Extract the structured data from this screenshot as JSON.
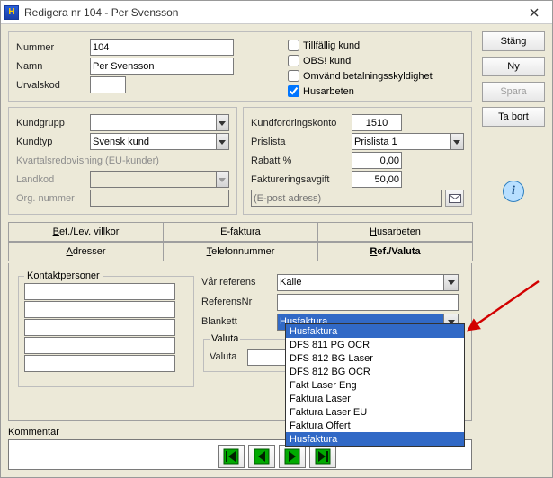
{
  "window": {
    "title": "Redigera nr 104 - Per Svensson"
  },
  "side_buttons": {
    "close": "Stäng",
    "new": "Ny",
    "save": "Spara",
    "delete": "Ta bort"
  },
  "top": {
    "labels": {
      "nummer": "Nummer",
      "namn": "Namn",
      "urvalskod": "Urvalskod"
    },
    "nummer": "104",
    "namn": "Per Svensson",
    "urvalskod": "",
    "checks": {
      "tillfallig": "Tillfällig kund",
      "obs": "OBS! kund",
      "omv": "Omvänd betalningsskyldighet",
      "hus": "Husarbeten"
    },
    "checked": {
      "tillfallig": false,
      "obs": false,
      "omv": false,
      "hus": true
    }
  },
  "left_group": {
    "labels": {
      "kundgrupp": "Kundgrupp",
      "kundtyp": "Kundtyp",
      "kvartals": "Kvartalsredovisning (EU-kunder)",
      "landkod": "Landkod",
      "orgnr": "Org. nummer"
    },
    "kundgrupp": "",
    "kundtyp": "Svensk kund",
    "landkod": "",
    "orgnr": ""
  },
  "right_group": {
    "labels": {
      "konto": "Kundfordringskonto",
      "prislista": "Prislista",
      "rabatt": "Rabatt %",
      "faktavgift": "Faktureringsavgift",
      "epost_ph": "(E-post adress)"
    },
    "konto": "1510",
    "prislista": "Prislista 1",
    "rabatt": "0,00",
    "faktavgift": "50,00",
    "epost": ""
  },
  "tabs": {
    "upper": {
      "bet": "Bet./Lev. villkor",
      "efakt": "E-faktura",
      "hus": "Husarbeten"
    },
    "lower": {
      "adr": "Adresser",
      "tel": "Telefonnummer",
      "ref": "Ref./Valuta"
    }
  },
  "kontakt_label": "Kontaktpersoner",
  "ref": {
    "labels": {
      "varref": "Vår referens",
      "refnr": "ReferensNr",
      "blankett": "Blankett",
      "valuta_group": "Valuta",
      "valuta": "Valuta"
    },
    "varref": "Kalle",
    "refnr": "",
    "blankett": "Husfaktura",
    "valuta": ""
  },
  "dropdown_options": [
    "DFS 811 PG OCR",
    "DFS 812 BG Laser",
    "DFS 812 BG OCR",
    "Fakt Laser Eng",
    "Faktura Laser",
    "Faktura Laser EU",
    "Faktura Offert",
    "Husfaktura"
  ],
  "dropdown_highlight_first": "Husfaktura",
  "dropdown_highlight_last": "Husfaktura",
  "kommentar_label": "Kommentar"
}
